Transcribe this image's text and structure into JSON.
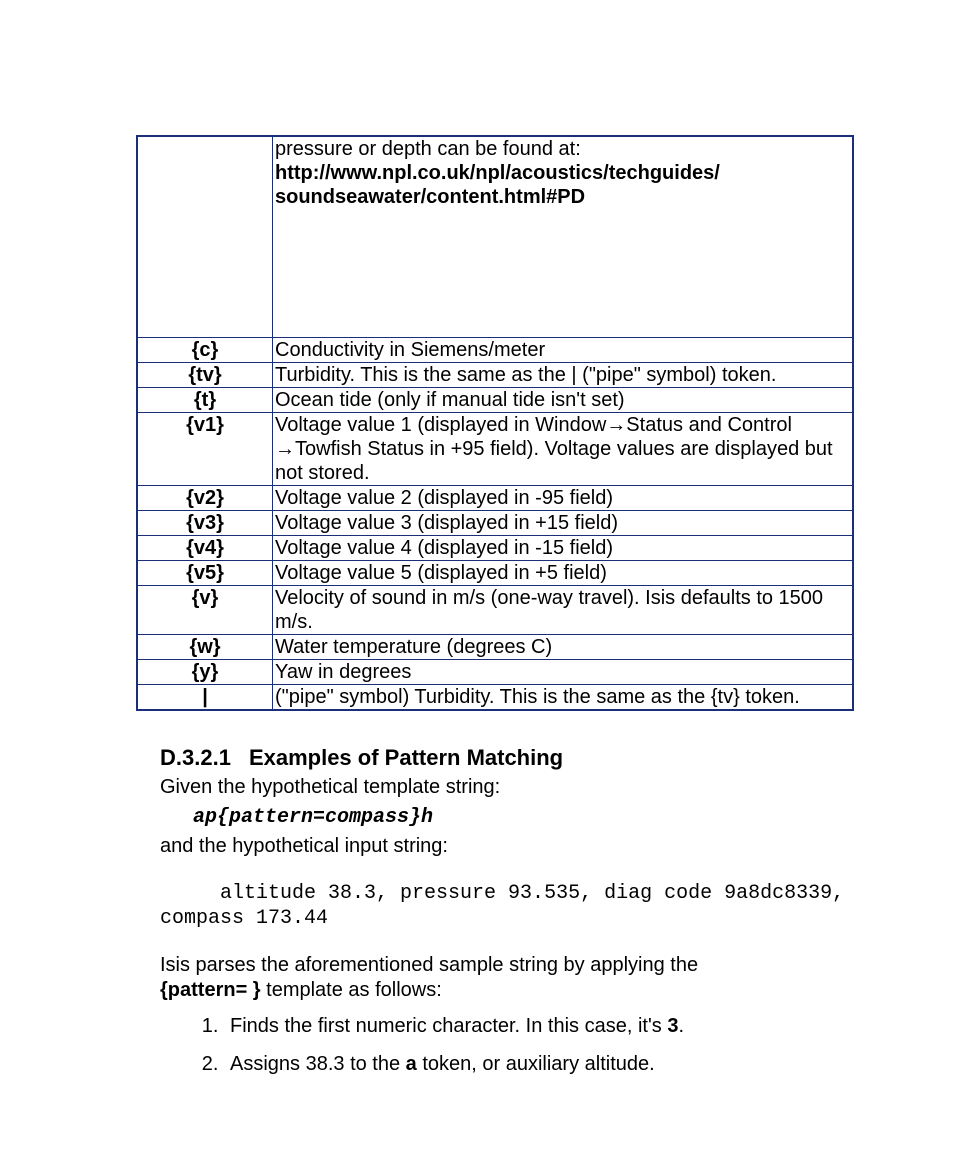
{
  "table": {
    "rows": [
      {
        "token": "",
        "desc_pre": "pressure or depth can be found at:",
        "desc_bold": "http://www.npl.co.uk/npl/acoustics/techguides/ soundseawater/content.html#PD",
        "tall": true
      },
      {
        "token": "{c}",
        "desc": "Conductivity in Siemens/meter"
      },
      {
        "token": "{tv}",
        "desc": "Turbidity. This is the same as the | (\"pipe\" symbol) token."
      },
      {
        "token": "{t}",
        "desc": "Ocean tide (only if manual tide isn't set)"
      },
      {
        "token": "{v1}",
        "desc": "Voltage value 1 (displayed in Window→Status and Control →Towfish Status in +95 field). Voltage values are displayed but not stored."
      },
      {
        "token": "{v2}",
        "desc": "Voltage value 2 (displayed in -95 field)"
      },
      {
        "token": "{v3}",
        "desc": "Voltage value 3 (displayed in +15 field)"
      },
      {
        "token": "{v4}",
        "desc": "Voltage value 4 (displayed in -15 field)"
      },
      {
        "token": "{v5}",
        "desc": "Voltage value 5 (displayed in +5 field)"
      },
      {
        "token": "{v}",
        "desc": "Velocity of sound in m/s (one-way travel). Isis defaults to 1500 m/s."
      },
      {
        "token": "{w}",
        "desc": "Water temperature (degrees C)"
      },
      {
        "token": "{y}",
        "desc": "Yaw in degrees"
      },
      {
        "token": "|",
        "desc": "(\"pipe\" symbol) Turbidity. This is the same as the {tv} token."
      }
    ]
  },
  "heading": {
    "number": "D.3.2.1",
    "title": "Examples of Pattern Matching"
  },
  "para1": "Given the hypothetical template string:",
  "template_string": "ap{pattern=compass}h",
  "para2": "and the hypothetical input string:",
  "mono_block": "     altitude 38.3, pressure 93.535, diag code 9a8dc8339,\ncompass 173.44",
  "para3_pre": "Isis parses the aforementioned sample string by applying the ",
  "para3_bold": "{pattern=                    }",
  "para3_post": " template as follows:",
  "steps": {
    "s1_a": "Finds the first numeric character. In this case, it's ",
    "s1_b": "3",
    "s1_c": ".",
    "s2_a": "Assigns 38.3 to the ",
    "s2_b": "a",
    "s2_c": " token, or auxiliary altitude."
  }
}
